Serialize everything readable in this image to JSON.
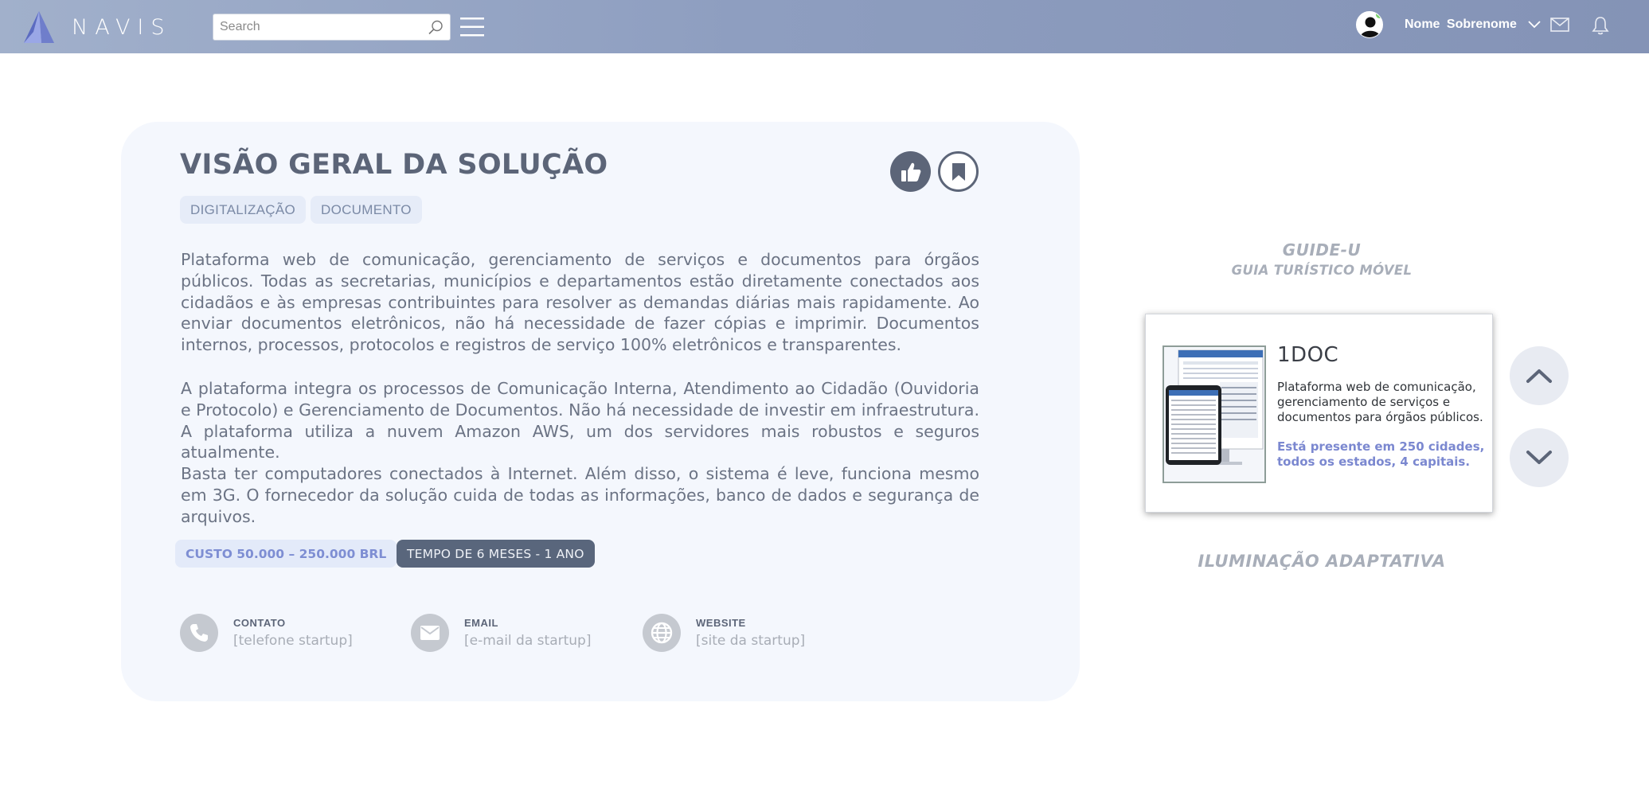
{
  "header": {
    "brand": "NAVIS",
    "search_placeholder": "Search",
    "user_name": "Nome Sobrenome",
    "icons": [
      "navis-logo-icon",
      "search-icon",
      "menu-icon",
      "avatar-icon",
      "chevron-down-icon",
      "mail-icon",
      "bell-icon"
    ]
  },
  "solution": {
    "title": "VISÃO GERAL DA SOLUÇÃO",
    "tags": [
      "DIGITALIZAÇÃO",
      "DOCUMENTO"
    ],
    "paragraphs": [
      "Plataforma web de comunicação, gerenciamento de serviços e documentos para órgãos públicos. Todas as secretarias, municípios e departamentos estão diretamente conectados aos cidadãos e às empresas contribuintes para resolver as demandas diárias mais rapidamente. Ao enviar documentos eletrônicos, não há necessidade de fazer cópias e imprimir. Documentos internos, processos, protocolos e registros de serviço 100% eletrônicos e transparentes.",
      "A plataforma integra os processos de Comunicação Interna, Atendimento ao Cidadão (Ouvidoria e Protocolo) e Gerenciamento de Documentos. Não há necessidade de investir em infraestrutura. A plataforma utiliza a nuvem Amazon AWS, um dos servidores mais robustos e seguros atualmente.",
      "Basta ter computadores conectados à Internet. Além disso, o sistema é leve, funciona mesmo em 3G. O fornecedor da solução cuida de todas as informações, banco de dados e segurança de arquivos."
    ],
    "cost": "CUSTO 50.000 – 250.000 BRL",
    "time": "TEMPO DE 6 MESES - 1 ANO",
    "contacts": [
      {
        "label": "CONTATO",
        "value": "[telefone startup]",
        "icon": "phone-icon"
      },
      {
        "label": "EMAIL",
        "value": "[e-mail da startup]",
        "icon": "envelope-icon"
      },
      {
        "label": "WEBSITE",
        "value": "[site da startup]",
        "icon": "globe-icon"
      }
    ],
    "actions": {
      "like_icon": "thumbs-up-icon",
      "bookmark_icon": "bookmark-icon"
    }
  },
  "carousel": {
    "previous": {
      "title": "GUIDE-U",
      "subtitle": "GUIA TURÍSTICO MÓVEL"
    },
    "current": {
      "title": "1DOC",
      "description": "Plataforma web de comunicação, gerenciamento de serviços e documentos para órgãos públicos.",
      "highlight": "Está presente em 250 cidades, todos os estados, 4 capitais."
    },
    "next": {
      "title": "ILUMINAÇÃO ADAPTATIVA"
    }
  },
  "colors": {
    "header_gradient_start": "#a1b0cb",
    "header_gradient_end": "#8493b6",
    "card_background": "#f4f7fd",
    "title_color": "#5c6578",
    "accent_blue": "#7b88d0",
    "time_badge": "#59667c"
  }
}
